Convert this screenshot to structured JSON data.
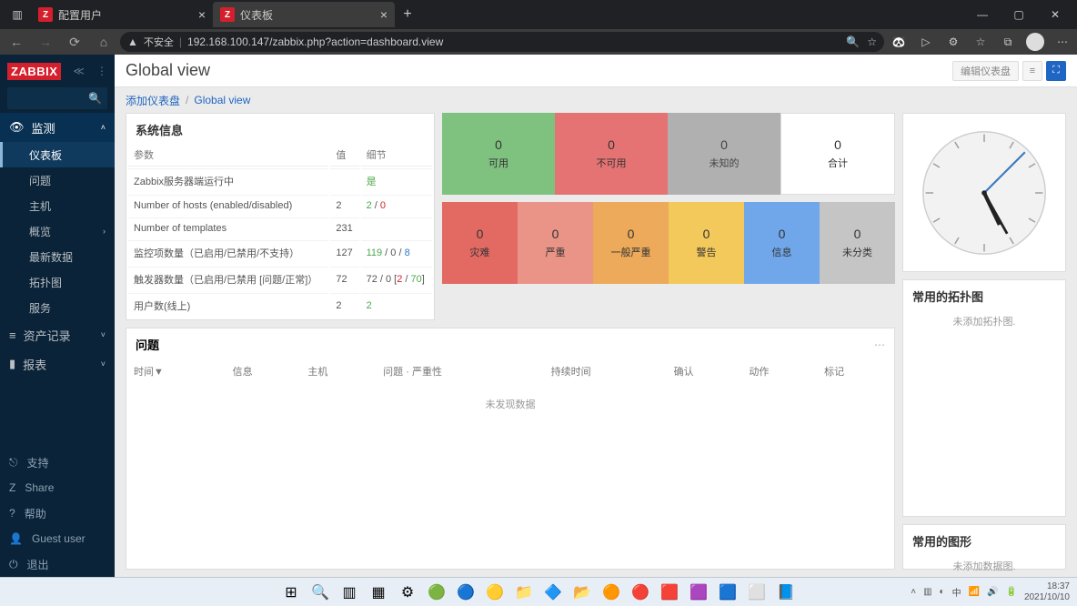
{
  "browser": {
    "tabs": [
      {
        "favicon": "Z",
        "title": "配置用户",
        "active": false
      },
      {
        "favicon": "Z",
        "title": "仪表板",
        "active": true
      }
    ],
    "url_warn": "不安全",
    "url": "192.168.100.147/zabbix.php?action=dashboard.view"
  },
  "sidebar": {
    "logo": "ZABBIX",
    "sections": {
      "monitor": {
        "label": "监测",
        "items": [
          {
            "label": "仪表板",
            "selected": true
          },
          {
            "label": "问题"
          },
          {
            "label": "主机"
          },
          {
            "label": "概览",
            "chev": true
          },
          {
            "label": "最新数据"
          },
          {
            "label": "拓扑图"
          },
          {
            "label": "服务"
          }
        ]
      },
      "inventory": {
        "label": "资产记录"
      },
      "reports": {
        "label": "报表"
      }
    },
    "footer": [
      {
        "icon": "support",
        "label": "支持"
      },
      {
        "icon": "share",
        "label": "Share"
      },
      {
        "icon": "help",
        "label": "帮助"
      },
      {
        "icon": "user",
        "label": "Guest user"
      },
      {
        "icon": "logout",
        "label": "退出"
      }
    ]
  },
  "header": {
    "title": "Global view",
    "edit_btn": "编辑仪表盘"
  },
  "breadcrumb": {
    "a": "添加仪表盘",
    "b": "Global view"
  },
  "sysinfo": {
    "title": "系统信息",
    "cols": {
      "param": "参数",
      "value": "值",
      "detail": "细节"
    },
    "rows": [
      {
        "p": "Zabbix服务器端运行中",
        "v": "",
        "d": "是",
        "dclass": "green"
      },
      {
        "p": "Number of hosts (enabled/disabled)",
        "v": "2",
        "d_html": "<span class='green'>2</span> / <span class='red'>0</span>"
      },
      {
        "p": "Number of templates",
        "v": "231",
        "d": ""
      },
      {
        "p": "监控项数量（已启用/已禁用/不支持）",
        "v": "127",
        "d_html": "<span class='green'>119</span> / <span>0</span> / <span class='blue'>8</span>"
      },
      {
        "p": "触发器数量（已启用/已禁用 [问题/正常]）",
        "v": "72",
        "d_html": "72 / 0 [<span class='red'>2</span> / <span class='green'>70</span>]"
      },
      {
        "p": "用户数(线上)",
        "v": "2",
        "d": "2",
        "dclass": "green"
      }
    ]
  },
  "status1": [
    {
      "n": "0",
      "l": "可用",
      "c": "sc-green"
    },
    {
      "n": "0",
      "l": "不可用",
      "c": "sc-red"
    },
    {
      "n": "0",
      "l": "未知的",
      "c": "sc-grey"
    },
    {
      "n": "0",
      "l": "合计",
      "c": "sc-white"
    }
  ],
  "status2": [
    {
      "n": "0",
      "l": "灾难",
      "c": "sc-darkred"
    },
    {
      "n": "0",
      "l": "严重",
      "c": "sc-red2"
    },
    {
      "n": "0",
      "l": "一般严重",
      "c": "sc-orange"
    },
    {
      "n": "0",
      "l": "警告",
      "c": "sc-yellow"
    },
    {
      "n": "0",
      "l": "信息",
      "c": "sc-blue"
    },
    {
      "n": "0",
      "l": "未分类",
      "c": "sc-lgrey"
    }
  ],
  "problems": {
    "title": "问题",
    "cols": [
      "时间▼",
      "信息",
      "主机",
      "问题 · 严重性",
      "持续时间",
      "确认",
      "动作",
      "标记"
    ],
    "empty": "未发现数据"
  },
  "side1": {
    "title": "常用的拓扑图",
    "text": "未添加拓扑图."
  },
  "side2": {
    "title": "常用的图形",
    "text": "未添加数据图."
  },
  "taskbar": {
    "time": "18:37",
    "date": "2021/10/10",
    "lang": "中"
  }
}
